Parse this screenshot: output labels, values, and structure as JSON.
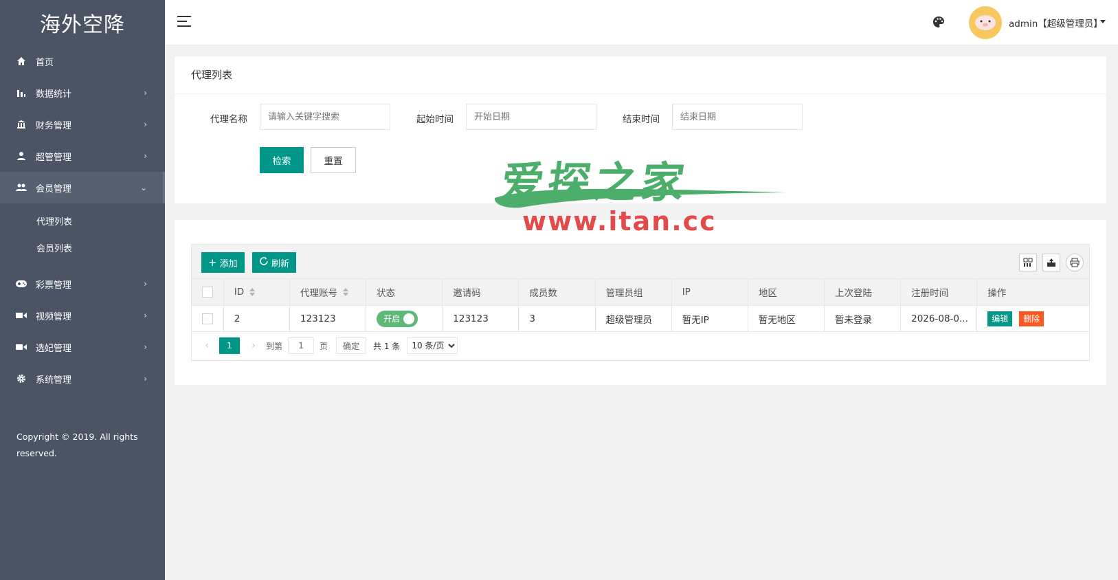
{
  "sidebar": {
    "logo": "海外空降",
    "items": [
      {
        "label": "首页",
        "icon": "home-icon",
        "arrow": ""
      },
      {
        "label": "数据统计",
        "icon": "bar-chart-icon",
        "arrow": "›"
      },
      {
        "label": "财务管理",
        "icon": "bank-icon",
        "arrow": "›"
      },
      {
        "label": "超管管理",
        "icon": "user-icon",
        "arrow": "›"
      },
      {
        "label": "会员管理",
        "icon": "users-icon",
        "arrow": "⌄"
      },
      {
        "label": "彩票管理",
        "icon": "gamepad-icon",
        "arrow": "›"
      },
      {
        "label": "视频管理",
        "icon": "video-icon",
        "arrow": "›"
      },
      {
        "label": "选妃管理",
        "icon": "camera-icon",
        "arrow": "›"
      },
      {
        "label": "系统管理",
        "icon": "gear-icon",
        "arrow": "›"
      }
    ],
    "submenu": [
      "代理列表",
      "会员列表"
    ],
    "copyright": "Copyright © 2019. All rights reserved."
  },
  "header": {
    "user": "admin【超级管理员】"
  },
  "search": {
    "title": "代理列表",
    "name_label": "代理名称",
    "name_placeholder": "请输入关键字搜索",
    "start_label": "起始时间",
    "start_placeholder": "开始日期",
    "end_label": "结束时间",
    "end_placeholder": "结束日期",
    "search_btn": "检索",
    "reset_btn": "重置"
  },
  "watermark": {
    "top": "爱探之家",
    "bottom": "www.itan.cc"
  },
  "table": {
    "add_btn": "添加",
    "refresh_btn": "刷新",
    "columns": [
      "ID",
      "代理账号",
      "状态",
      "邀请码",
      "成员数",
      "管理员组",
      "IP",
      "地区",
      "上次登陆",
      "注册时间",
      "操作"
    ],
    "rows": [
      {
        "id": "2",
        "account": "123123",
        "status": "开启",
        "invite": "123123",
        "members": "3",
        "group": "超级管理员",
        "ip": "暂无IP",
        "region": "暂无地区",
        "last_login": "暂未登录",
        "reg_time": "2026-08-0...",
        "edit": "编辑",
        "delete": "删除"
      }
    ]
  },
  "pager": {
    "current": "1",
    "goto_label": "到第",
    "goto_value": "1",
    "page_unit": "页",
    "confirm": "确定",
    "total": "共 1 条",
    "per_page": "10 条/页"
  },
  "colors": {
    "primary": "#009688",
    "danger": "#ff5722",
    "switch_on": "#5fb878",
    "sidebar_bg": "#4a5464"
  }
}
